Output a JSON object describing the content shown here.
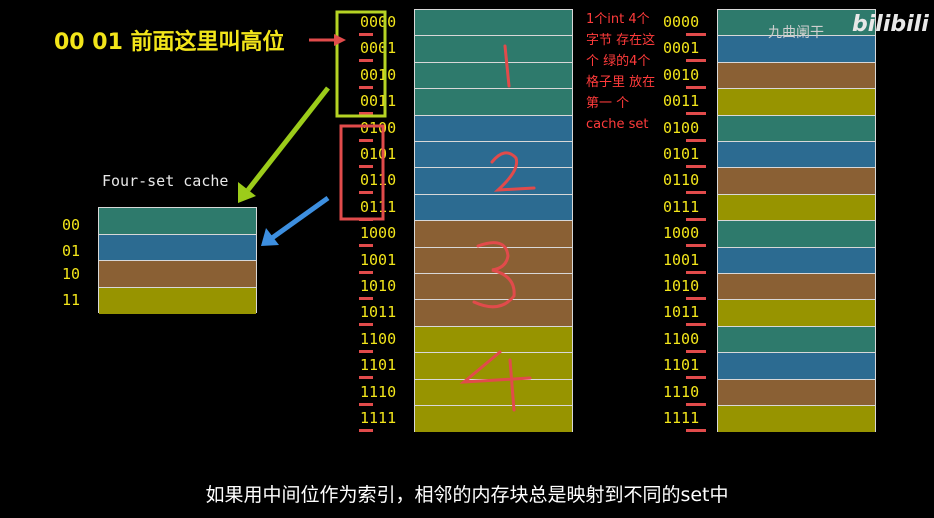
{
  "note_text": "00 01 前面这里叫高位",
  "cache": {
    "title": "Four-set cache",
    "rows": [
      {
        "label": "00",
        "color": "#2e7a6c"
      },
      {
        "label": "01",
        "color": "#2c6b91"
      },
      {
        "label": "10",
        "color": "#8a6034"
      },
      {
        "label": "11",
        "color": "#979400"
      }
    ]
  },
  "addresses": [
    "0000",
    "0001",
    "0010",
    "0011",
    "0100",
    "0101",
    "0110",
    "0111",
    "1000",
    "1001",
    "1010",
    "1011",
    "1100",
    "1101",
    "1110",
    "1111"
  ],
  "left_column_colors": [
    "#2e7a6c",
    "#2e7a6c",
    "#2e7a6c",
    "#2e7a6c",
    "#2c6b91",
    "#2c6b91",
    "#2c6b91",
    "#2c6b91",
    "#8a6034",
    "#8a6034",
    "#8a6034",
    "#8a6034",
    "#979400",
    "#979400",
    "#979400",
    "#979400"
  ],
  "right_column_colors": [
    "#2e7a6c",
    "#2c6b91",
    "#8a6034",
    "#979400",
    "#2e7a6c",
    "#2c6b91",
    "#8a6034",
    "#979400",
    "#2e7a6c",
    "#2c6b91",
    "#8a6034",
    "#979400",
    "#2e7a6c",
    "#2c6b91",
    "#8a6034",
    "#979400"
  ],
  "handwritten_numbers": [
    "1",
    "2",
    "3",
    "4"
  ],
  "red_note": "1个int 4个字节 存在这个 绿的4个 格子里 放在第一 个cache set",
  "caption": "如果用中间位作为索引，相邻的内存块总是映射到不同的set中",
  "watermark": "九曲阑干",
  "logo": "bilibili",
  "colors": {
    "yellow": "#f2e51a",
    "red": "#e14b4b",
    "green_arrow": "#9ccc1a",
    "blue_arrow": "#3d8fe0",
    "highlight_box": "#b6d324"
  }
}
